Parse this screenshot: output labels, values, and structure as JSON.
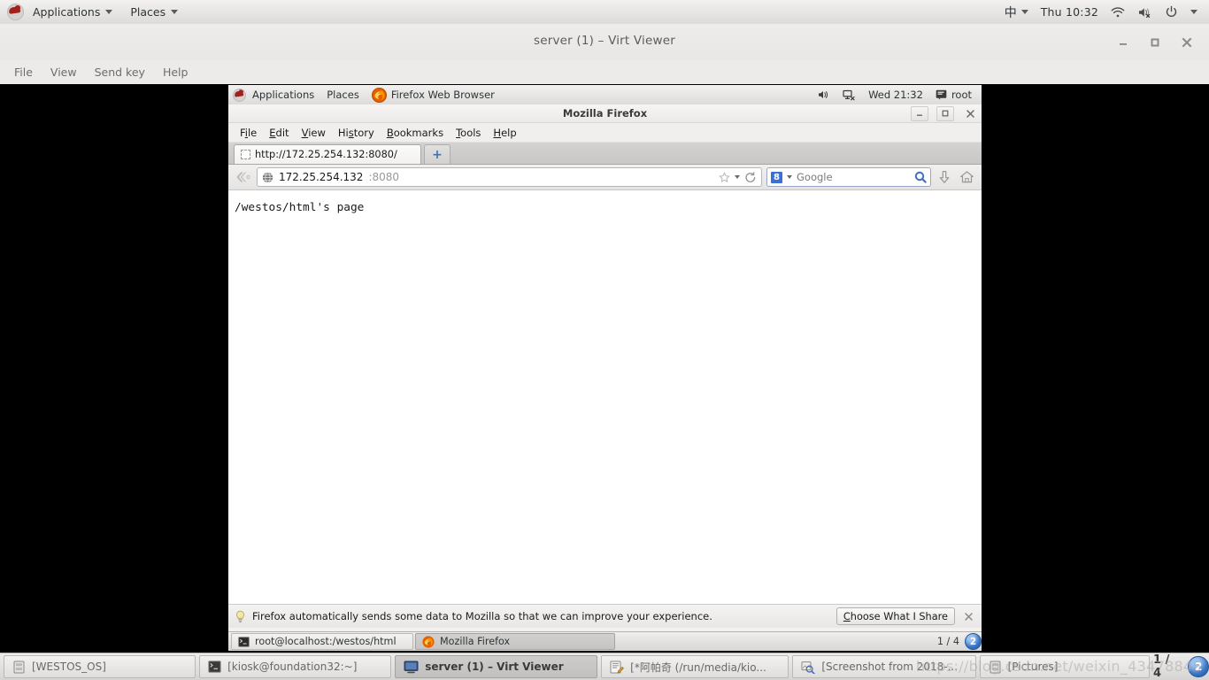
{
  "host_panel": {
    "logo_icon": "redhat-logo-icon",
    "menus": [
      {
        "label": "Applications",
        "icon": "chevron-down-icon"
      },
      {
        "label": "Places",
        "icon": "chevron-down-icon"
      }
    ],
    "ime": "中",
    "clock": "Thu 10:32",
    "icons": [
      "wifi-icon",
      "speaker-muted-icon",
      "power-icon",
      "chevron-down-icon"
    ]
  },
  "virt_viewer": {
    "title": "server (1) – Virt Viewer",
    "window_buttons": {
      "minimize": "–",
      "maximize": "□",
      "close": "×"
    },
    "menus": [
      "File",
      "View",
      "Send key",
      "Help"
    ]
  },
  "guest_panel": {
    "logo_icon": "redhat-logo-icon",
    "menus": [
      "Applications",
      "Places"
    ],
    "active_app": "Firefox Web Browser",
    "active_app_icon": "firefox-icon",
    "tray_icons": [
      "speaker-icon",
      "network-disconnected-icon"
    ],
    "clock": "Wed 21:32",
    "user": "root",
    "user_icon": "user-icon"
  },
  "firefox": {
    "title": "Mozilla Firefox",
    "window_buttons": {
      "minimize": "–",
      "maximize": "□",
      "close": "×"
    },
    "menu": [
      {
        "pre": "F",
        "key": "i",
        "post": "le"
      },
      {
        "pre": "",
        "key": "E",
        "post": "dit"
      },
      {
        "pre": "",
        "key": "V",
        "post": "iew"
      },
      {
        "pre": "Hi",
        "key": "s",
        "post": "tory"
      },
      {
        "pre": "",
        "key": "B",
        "post": "ookmarks"
      },
      {
        "pre": "",
        "key": "T",
        "post": "ools"
      },
      {
        "pre": "",
        "key": "H",
        "post": "elp"
      }
    ],
    "tab": {
      "title": "http://172.25.254.132:8080/",
      "favicon": "blank-favicon-icon"
    },
    "new_tab_label": "+",
    "navbar": {
      "back_forward_icon": "back-forward-icon",
      "site_icon": "globe-icon",
      "url_host": "172.25.254.132",
      "url_port": ":8080",
      "star_icon": "bookmark-star-icon",
      "dropdown_icon": "chevron-down-icon",
      "reload_icon": "reload-icon",
      "search_engine": "Google",
      "search_engine_icon": "google-g-icon",
      "search_engine_badge": "8",
      "search_go_icon": "magnifier-icon",
      "downloads_icon": "download-arrow-icon",
      "home_icon": "home-icon"
    },
    "content": "/westos/html's page",
    "notification": {
      "icon": "lightbulb-icon",
      "text": "Firefox automatically sends some data to Mozilla so that we can improve your experience.",
      "button": {
        "pre": "",
        "key": "C",
        "post": "hoose What I Share"
      },
      "close": "×"
    },
    "taskbar": [
      {
        "label": "root@localhost:/westos/html",
        "icon": "terminal-icon",
        "active": false
      },
      {
        "label": "Mozilla Firefox",
        "icon": "firefox-icon",
        "active": true
      }
    ],
    "workspace": {
      "label": "1 / 4",
      "badge": "2"
    }
  },
  "host_taskbar": {
    "items": [
      {
        "label": "[WESTOS_OS]",
        "icon": "file-manager-icon",
        "active": false
      },
      {
        "label": "[kiosk@foundation32:~]",
        "icon": "terminal-icon",
        "active": false
      },
      {
        "label": "server (1) – Virt Viewer",
        "icon": "display-icon",
        "active": true
      },
      {
        "label": "[*阿帕奇 (/run/media/kio...",
        "icon": "text-editor-icon",
        "active": false
      },
      {
        "label": "[Screenshot from 2018-...",
        "icon": "image-viewer-icon",
        "active": false
      },
      {
        "label": "[Pictures]",
        "icon": "file-manager-icon",
        "active": false
      }
    ],
    "workspace": {
      "label": "1 / 4",
      "badge": "2"
    }
  },
  "watermark": "https://blog.csdn.net/weixin_43478846",
  "colors": {
    "panel_bg": "#e9e8e6",
    "accent_blue": "#3a76c4",
    "firefox_orange": "#e66000",
    "redhat_red": "#a0221c",
    "desktop_black": "#000000"
  }
}
